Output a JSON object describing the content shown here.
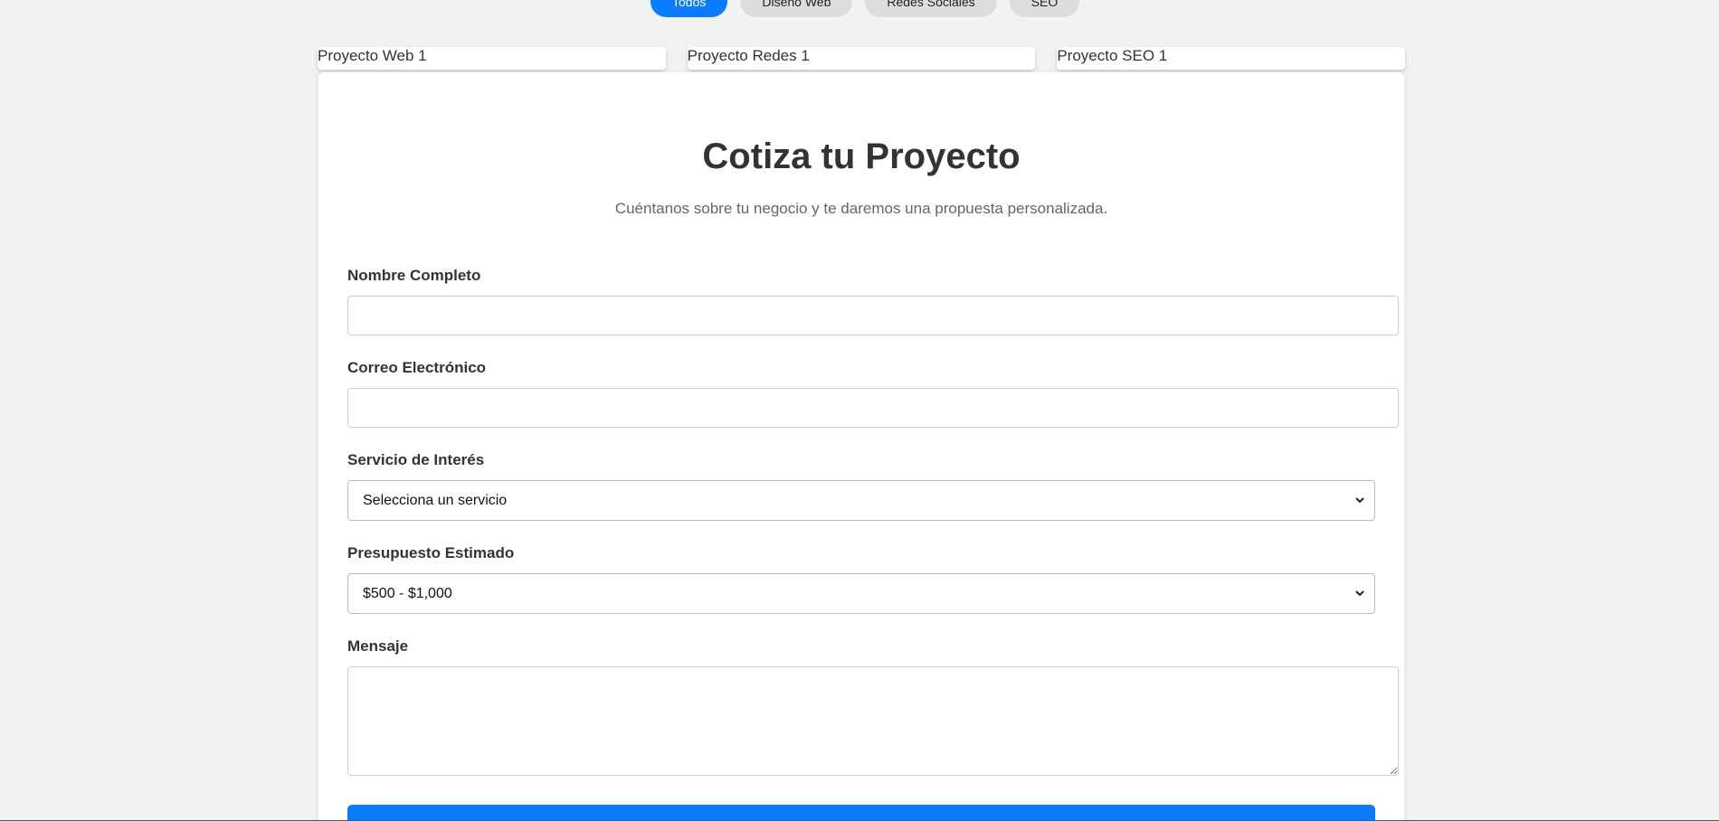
{
  "filters": {
    "items": [
      {
        "label": "Todos"
      },
      {
        "label": "Diseño Web"
      },
      {
        "label": "Redes Sociales"
      },
      {
        "label": "SEO"
      }
    ]
  },
  "gallery": {
    "cards": [
      {
        "alt": "Proyecto Web 1"
      },
      {
        "alt": "Proyecto Redes 1"
      },
      {
        "alt": "Proyecto SEO 1"
      }
    ]
  },
  "quote": {
    "title": "Cotiza tu Proyecto",
    "subtitle": "Cuéntanos sobre tu negocio y te daremos una propuesta personalizada.",
    "name_label": "Nombre Completo",
    "name_value": "",
    "email_label": "Correo Electrónico",
    "email_value": "",
    "service_label": "Servicio de Interés",
    "service_selected": "Selecciona un servicio",
    "budget_label": "Presupuesto Estimado",
    "budget_selected": "$500 - $1,000",
    "message_label": "Mensaje",
    "message_value": ""
  },
  "colors": {
    "accent": "#0a7cff",
    "background": "#f2f2f2",
    "card": "#ffffff"
  }
}
